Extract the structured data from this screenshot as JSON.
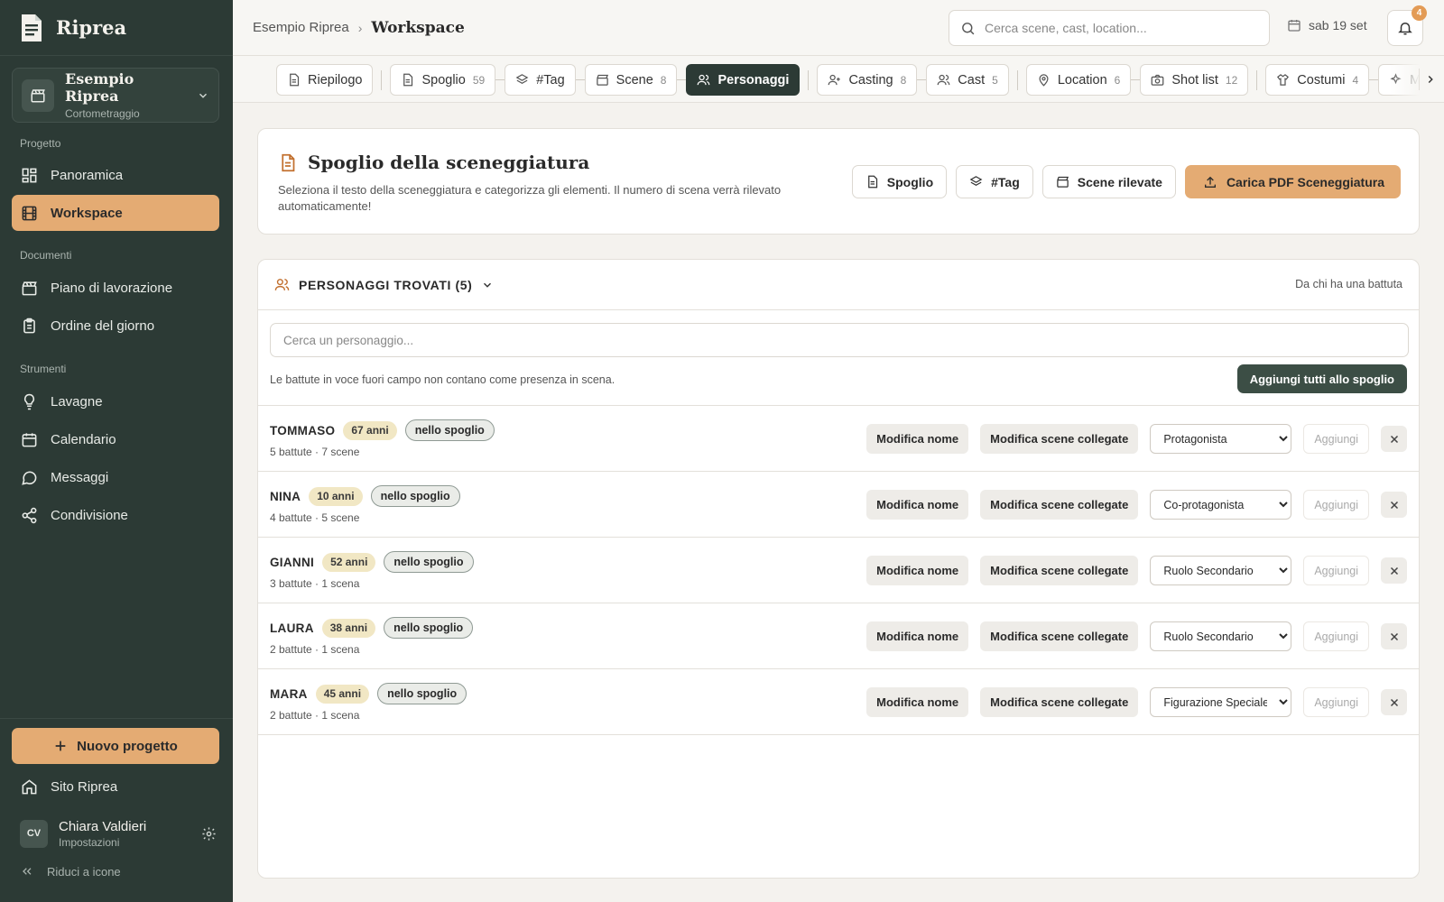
{
  "app": {
    "name": "Riprea"
  },
  "project": {
    "name": "Esempio Riprea",
    "type": "Cortometraggio"
  },
  "sidebar": {
    "sections": [
      {
        "label": "Progetto",
        "items": [
          {
            "label": "Panoramica",
            "icon": "grid-icon"
          },
          {
            "label": "Workspace",
            "icon": "film-icon",
            "active": true
          }
        ]
      },
      {
        "label": "Documenti",
        "items": [
          {
            "label": "Piano di lavorazione",
            "icon": "clapper-icon"
          },
          {
            "label": "Ordine del giorno",
            "icon": "clipboard-icon"
          }
        ]
      },
      {
        "label": "Strumenti",
        "items": [
          {
            "label": "Lavagne",
            "icon": "lightbulb-icon"
          },
          {
            "label": "Calendario",
            "icon": "calendar-icon"
          },
          {
            "label": "Messaggi",
            "icon": "chat-icon"
          },
          {
            "label": "Condivisione",
            "icon": "share-icon"
          }
        ]
      }
    ],
    "new_project_label": "Nuovo progetto",
    "site_label": "Sito Riprea",
    "user": {
      "initials": "CV",
      "name": "Chiara Valdieri",
      "sub": "Impostazioni"
    },
    "collapse_label": "Riduci a icone"
  },
  "topbar": {
    "breadcrumb_parent": "Esempio Riprea",
    "breadcrumb_current": "Workspace",
    "search_placeholder": "Cerca scene, cast, location...",
    "date": "sab 19 set",
    "notifications": "4"
  },
  "tabs": [
    {
      "label": "Riepilogo",
      "count": "",
      "icon": "doc-icon"
    },
    {
      "label": "Spoglio",
      "count": "59",
      "icon": "doc-icon"
    },
    {
      "label": "#Tag",
      "count": "",
      "icon": "layers-icon"
    },
    {
      "label": "Scene",
      "count": "8",
      "icon": "clapper-icon"
    },
    {
      "label": "Personaggi",
      "count": "",
      "icon": "users-icon",
      "active": true
    },
    {
      "label": "Casting",
      "count": "8",
      "icon": "user-plus-icon"
    },
    {
      "label": "Cast",
      "count": "5",
      "icon": "users-icon"
    },
    {
      "label": "Location",
      "count": "6",
      "icon": "pin-icon"
    },
    {
      "label": "Shot list",
      "count": "12",
      "icon": "camera-icon"
    },
    {
      "label": "Costumi",
      "count": "4",
      "icon": "shirt-icon"
    },
    {
      "label": "Ma",
      "count": "",
      "icon": "sparkle-icon"
    }
  ],
  "hero": {
    "title": "Spoglio della sceneggiatura",
    "description": "Seleziona il testo della sceneggiatura e categorizza gli elementi. Il numero di scena verrà rilevato automaticamente!",
    "btn_spoglio": "Spoglio",
    "btn_tag": "#Tag",
    "btn_scene": "Scene rilevate",
    "btn_upload": "Carica PDF Sceneggiatura"
  },
  "characters": {
    "header": "PERSONAGGI TROVATI (5)",
    "header_note": "Da chi ha una battuta",
    "search_placeholder": "Cerca un personaggio...",
    "note": "Le battute in voce fuori campo non contano come presenza in scena.",
    "add_all_label": "Aggiungi tutti allo spoglio",
    "edit_name_label": "Modifica nome",
    "edit_scenes_label": "Modifica scene collegate",
    "add_label": "Aggiungi",
    "role_options": [
      "Protagonista",
      "Co-protagonista",
      "Ruolo Secondario",
      "Figurazione Speciale"
    ],
    "rows": [
      {
        "name": "TOMMASO",
        "age": "67 anni",
        "tag": "nello spoglio",
        "meta": "5 battute · 7 scene",
        "role": "Protagonista"
      },
      {
        "name": "NINA",
        "age": "10 anni",
        "tag": "nello spoglio",
        "meta": "4 battute · 5 scene",
        "role": "Co-protagonista"
      },
      {
        "name": "GIANNI",
        "age": "52 anni",
        "tag": "nello spoglio",
        "meta": "3 battute · 1 scena",
        "role": "Ruolo Secondario"
      },
      {
        "name": "LAURA",
        "age": "38 anni",
        "tag": "nello spoglio",
        "meta": "2 battute · 1 scena",
        "role": "Ruolo Secondario"
      },
      {
        "name": "MARA",
        "age": "45 anni",
        "tag": "nello spoglio",
        "meta": "2 battute · 1 scena",
        "role": "Figurazione Speciale"
      }
    ]
  },
  "colors": {
    "sidebar": "#2c3a35",
    "accent": "#e4ab73",
    "dark_button": "#3c4e45",
    "age_badge": "#f1e7c4"
  }
}
